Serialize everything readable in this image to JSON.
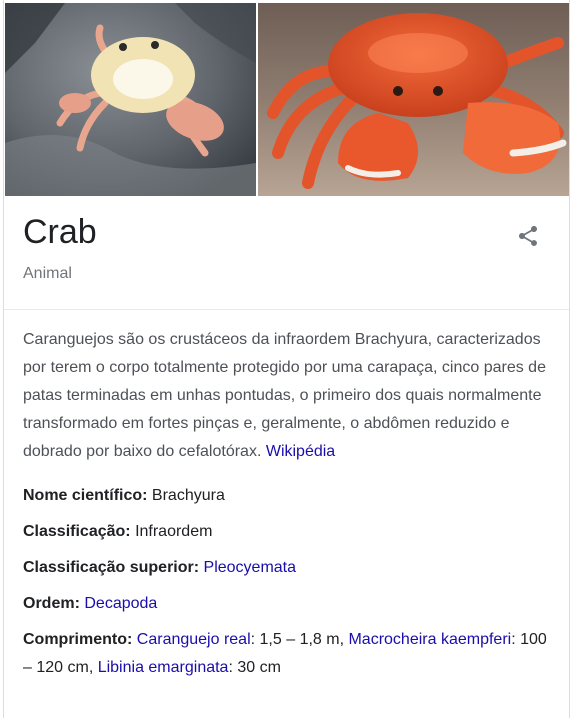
{
  "images": {
    "left_alt": "crab on rock",
    "right_alt": "red crab on sand"
  },
  "header": {
    "title": "Crab",
    "subtitle": "Animal"
  },
  "description": {
    "text": "Caranguejos são os crustáceos da infraordem Brachyura, caracterizados por terem o corpo totalmente protegido por uma carapaça, cinco pares de patas terminadas em unhas pontudas, o primeiro dos quais normalmente transformado em fortes pinças e, geralmente, o abdômen reduzido e dobrado por baixo do cefalotórax.",
    "source_link": "Wikipédia"
  },
  "facts": {
    "scientific_name": {
      "label": "Nome científico:",
      "value": "Brachyura"
    },
    "classification": {
      "label": "Classificação:",
      "value": "Infraordem"
    },
    "superior": {
      "label": "Classificação superior:",
      "value": "Pleocyemata"
    },
    "order": {
      "label": "Ordem:",
      "value": "Decapoda"
    },
    "length": {
      "label": "Comprimento:",
      "item1_link": "Caranguejo real",
      "item1_value": ": 1,5 – 1,8 m, ",
      "item2_link": "Macrocheira kaempferi",
      "item2_value": ": 100 – 120 cm, ",
      "item3_link": "Libinia emarginata",
      "item3_value": ": 30 cm"
    }
  },
  "icons": {
    "share": "share-icon"
  },
  "colors": {
    "link": "#1a0dab",
    "muted": "#70757a",
    "text": "#202124"
  }
}
